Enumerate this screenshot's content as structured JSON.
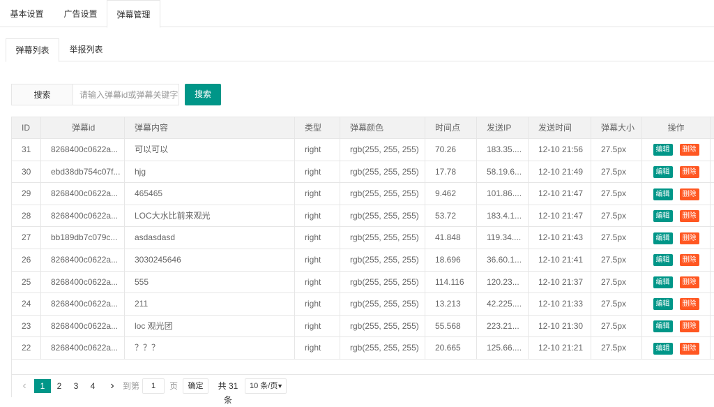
{
  "top_tabs": [
    {
      "label": "基本设置"
    },
    {
      "label": "广告设置"
    },
    {
      "label": "弹幕管理"
    }
  ],
  "sub_tabs": [
    {
      "label": "弹幕列表"
    },
    {
      "label": "举报列表"
    }
  ],
  "search": {
    "label": "搜索",
    "placeholder": "请输入弹幕id或弹幕关键字",
    "button": "搜索"
  },
  "table": {
    "columns": [
      "ID",
      "弹幕id",
      "弹幕内容",
      "类型",
      "弹幕颜色",
      "时间点",
      "发送IP",
      "发送时间",
      "弹幕大小",
      "操作"
    ],
    "actions": {
      "edit": "编辑",
      "delete": "删除"
    },
    "rows": [
      [
        "31",
        "8268400c0622a...",
        "可以可以",
        "right",
        "rgb(255, 255, 255)",
        "70.26",
        "183.35....",
        "12-10 21:56",
        "27.5px"
      ],
      [
        "30",
        "ebd38db754c07f...",
        "hjg",
        "right",
        "rgb(255, 255, 255)",
        "17.78",
        "58.19.6...",
        "12-10 21:49",
        "27.5px"
      ],
      [
        "29",
        "8268400c0622a...",
        "465465",
        "right",
        "rgb(255, 255, 255)",
        "9.462",
        "101.86....",
        "12-10 21:47",
        "27.5px"
      ],
      [
        "28",
        "8268400c0622a...",
        "LOC大水比前来观光",
        "right",
        "rgb(255, 255, 255)",
        "53.72",
        "183.4.1...",
        "12-10 21:47",
        "27.5px"
      ],
      [
        "27",
        "bb189db7c079c...",
        "asdasdasd",
        "right",
        "rgb(255, 255, 255)",
        "41.848",
        "119.34....",
        "12-10 21:43",
        "27.5px"
      ],
      [
        "26",
        "8268400c0622a...",
        "3030245646",
        "right",
        "rgb(255, 255, 255)",
        "18.696",
        "36.60.1...",
        "12-10 21:41",
        "27.5px"
      ],
      [
        "25",
        "8268400c0622a...",
        "555",
        "right",
        "rgb(255, 255, 255)",
        "114.116",
        "120.23...",
        "12-10 21:37",
        "27.5px"
      ],
      [
        "24",
        "8268400c0622a...",
        "211",
        "right",
        "rgb(255, 255, 255)",
        "13.213",
        "42.225....",
        "12-10 21:33",
        "27.5px"
      ],
      [
        "23",
        "8268400c0622a...",
        "loc 观光团",
        "right",
        "rgb(255, 255, 255)",
        "55.568",
        "223.21...",
        "12-10 21:30",
        "27.5px"
      ],
      [
        "22",
        "8268400c0622a...",
        "？？？",
        "right",
        "rgb(255, 255, 255)",
        "20.665",
        "125.66....",
        "12-10 21:21",
        "27.5px"
      ]
    ]
  },
  "pagination": {
    "prev": "‹",
    "pages": [
      "1",
      "2",
      "3",
      "4"
    ],
    "next": "›",
    "goto_label": "到第",
    "goto_value": "1",
    "page_unit": "页",
    "confirm": "确定",
    "total": "共 31 条",
    "page_size": "10 条/页"
  },
  "colors": {
    "primary": "#009688",
    "danger": "#ff5722"
  }
}
